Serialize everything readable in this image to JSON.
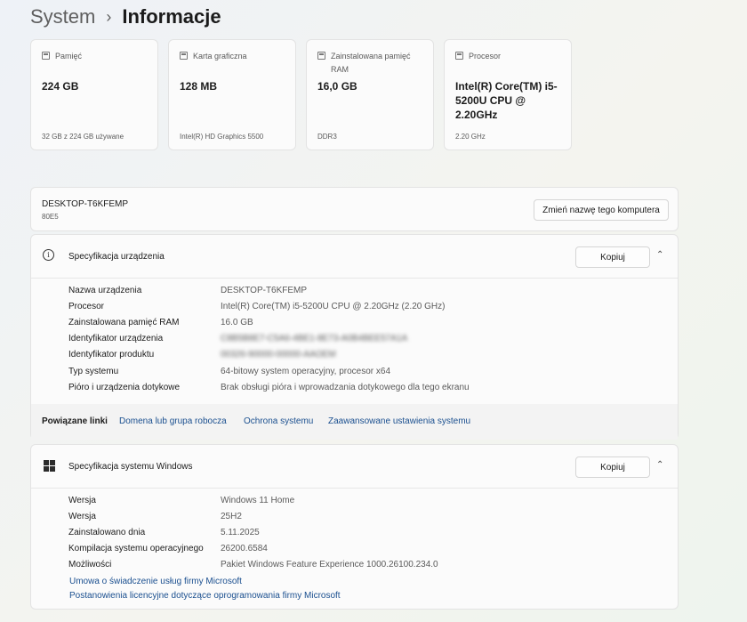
{
  "breadcrumb": {
    "parent": "System",
    "separator": "›",
    "current": "Informacje"
  },
  "cards": [
    {
      "title": "Pamięć",
      "value": "224 GB",
      "sub": "32 GB z 224 GB używane",
      "icon": "storage-icon"
    },
    {
      "title": "Karta graficzna",
      "value": "128 MB",
      "sub": "Intel(R) HD Graphics 5500",
      "icon": "gpu-icon"
    },
    {
      "title": "Zainstalowana pamięć RAM",
      "value": "16,0 GB",
      "sub": "DDR3",
      "icon": "ram-icon"
    },
    {
      "title": "Procesor",
      "value": "Intel(R) Core(TM) i5-5200U CPU @ 2.20GHz",
      "sub": "2.20 GHz",
      "icon": "cpu-icon"
    }
  ],
  "pc": {
    "name": "DESKTOP-T6KFEMP",
    "model": "80E5",
    "rename_label": "Zmień nazwę tego komputera"
  },
  "device_spec": {
    "title": "Specyfikacja urządzenia",
    "copy_label": "Kopiuj",
    "rows": [
      {
        "key": "Nazwa urządzenia",
        "value": "DESKTOP-T6KFEMP"
      },
      {
        "key": "Procesor",
        "value": "Intel(R) Core(TM) i5-5200U CPU @ 2.20GHz (2.20 GHz)"
      },
      {
        "key": "Zainstalowana pamięć RAM",
        "value": "16.0 GB"
      },
      {
        "key": "Identyfikator urządzenia",
        "value": "C8B5B8E7-C5A6-4BE1-8E73-A0B4BEE57A1A"
      },
      {
        "key": "Identyfikator produktu",
        "value": "00326-90000-00000-AAOEM"
      },
      {
        "key": "Typ systemu",
        "value": "64-bitowy system operacyjny, procesor x64"
      },
      {
        "key": "Pióro i urządzenia dotykowe",
        "value": "Brak obsługi pióra i wprowadzania dotykowego dla tego ekranu"
      }
    ]
  },
  "related": {
    "label": "Powiązane linki",
    "links": [
      "Domena lub grupa robocza",
      "Ochrona systemu",
      "Zaawansowane ustawienia systemu"
    ]
  },
  "windows_spec": {
    "title": "Specyfikacja systemu Windows",
    "copy_label": "Kopiuj",
    "rows": [
      {
        "key": "Wersja",
        "value": "Windows 11 Home"
      },
      {
        "key": "Wersja",
        "value": "25H2"
      },
      {
        "key": "Zainstalowano dnia",
        "value": "5.11.2025"
      },
      {
        "key": "Kompilacja systemu operacyjnego",
        "value": "26200.6584"
      },
      {
        "key": "Możliwości",
        "value": "Pakiet Windows Feature Experience 1000.26100.234.0"
      }
    ],
    "links": [
      "Umowa o świadczenie usług firmy Microsoft",
      "Postanowienia licencyjne dotyczące oprogramowania firmy Microsoft"
    ]
  },
  "icons": {
    "expand": "chevron-up-icon",
    "info": "info-icon",
    "windows": "windows-logo-icon"
  }
}
